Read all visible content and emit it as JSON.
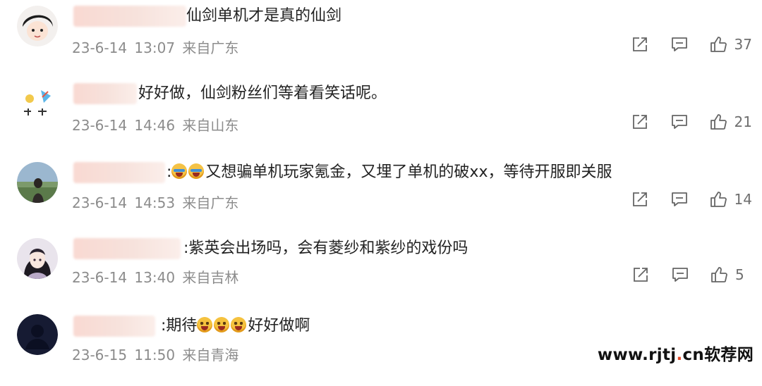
{
  "comments": [
    {
      "text": "仙剑单机才是真的仙剑",
      "date": "23-6-14",
      "time": "13:07",
      "location": "来自广东",
      "likes": "37"
    },
    {
      "text": "好好做，仙剑粉丝们等着看笑话呢。",
      "date": "23-6-14",
      "time": "14:46",
      "location": "来自山东",
      "likes": "21"
    },
    {
      "text_prefix": ":",
      "text": "又想骗单机玩家氪金，又埋了单机的破xx，等待开服即关服",
      "date": "23-6-14",
      "time": "14:53",
      "location": "来自广东",
      "likes": "14"
    },
    {
      "text": ":紫英会出场吗，会有菱纱和紫纱的戏份吗",
      "date": "23-6-14",
      "time": "13:40",
      "location": "来自吉林",
      "likes": "5"
    },
    {
      "text": ":期待",
      "text_suffix": "好好做啊",
      "date": "23-6-15",
      "time": "11:50",
      "location": "来自青海"
    }
  ],
  "watermark": {
    "prefix": "www.",
    "main": "rjtj",
    "dot": ".",
    "domain": "cn",
    "brand": "软荐网"
  },
  "icons": {
    "share": "share-icon",
    "reply": "comment-icon",
    "like": "thumbs-up-icon"
  }
}
